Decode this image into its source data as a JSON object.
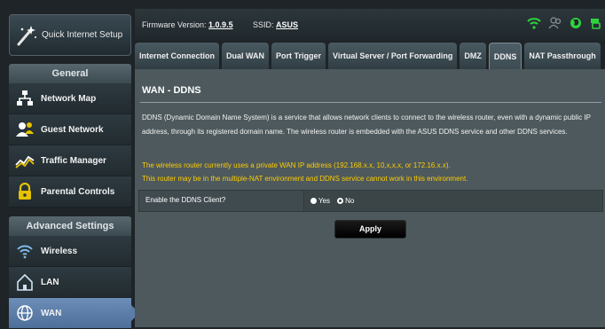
{
  "sidebar": {
    "quick_setup_label": "Quick Internet Setup",
    "general_heading": "General",
    "general_items": [
      {
        "label": "Network Map",
        "icon": "network-map-icon"
      },
      {
        "label": "Guest Network",
        "icon": "guest-network-icon"
      },
      {
        "label": "Traffic Manager",
        "icon": "traffic-manager-icon"
      },
      {
        "label": "Parental Controls",
        "icon": "parental-controls-icon"
      }
    ],
    "advanced_heading": "Advanced Settings",
    "advanced_items": [
      {
        "label": "Wireless",
        "icon": "wireless-icon"
      },
      {
        "label": "LAN",
        "icon": "lan-icon"
      },
      {
        "label": "WAN",
        "icon": "wan-icon",
        "active": true
      }
    ]
  },
  "topbar": {
    "firmware_label": "Firmware Version:",
    "firmware_value": "1.0.9.5",
    "ssid_label": "SSID:",
    "ssid_value": "ASUS",
    "status_icons": [
      "wifi-icon",
      "users-icon",
      "globe-icon",
      "usb-icon"
    ]
  },
  "tabs": [
    {
      "label": "Internet Connection"
    },
    {
      "label": "Dual WAN"
    },
    {
      "label": "Port Trigger"
    },
    {
      "label": "Virtual Server / Port Forwarding"
    },
    {
      "label": "DMZ"
    },
    {
      "label": "DDNS",
      "active": true
    },
    {
      "label": "NAT Passthrough"
    }
  ],
  "content": {
    "title": "WAN - DDNS",
    "description": "DDNS (Dynamic Domain Name System) is a service that allows network clients to connect to the wireless router, even with a dynamic public IP address, through its registered domain name. The wireless router is embedded with the ASUS DDNS service and other DDNS services.",
    "warning_line1": "The wireless router currently uses a private WAN IP address (192.168.x.x, 10,x,x,x, or 172.16.x.x).",
    "warning_line2": "This router may be in the multiple-NAT environment and DDNS service cannot work in this environment.",
    "setting_label": "Enable the DDNS Client?",
    "option_yes": "Yes",
    "option_no": "No",
    "selected_option": "Yes",
    "apply_label": "Apply"
  },
  "colors": {
    "accent_active": "#5a7ca8",
    "warning": "#ffcc00",
    "status_green": "#2ed43c"
  }
}
